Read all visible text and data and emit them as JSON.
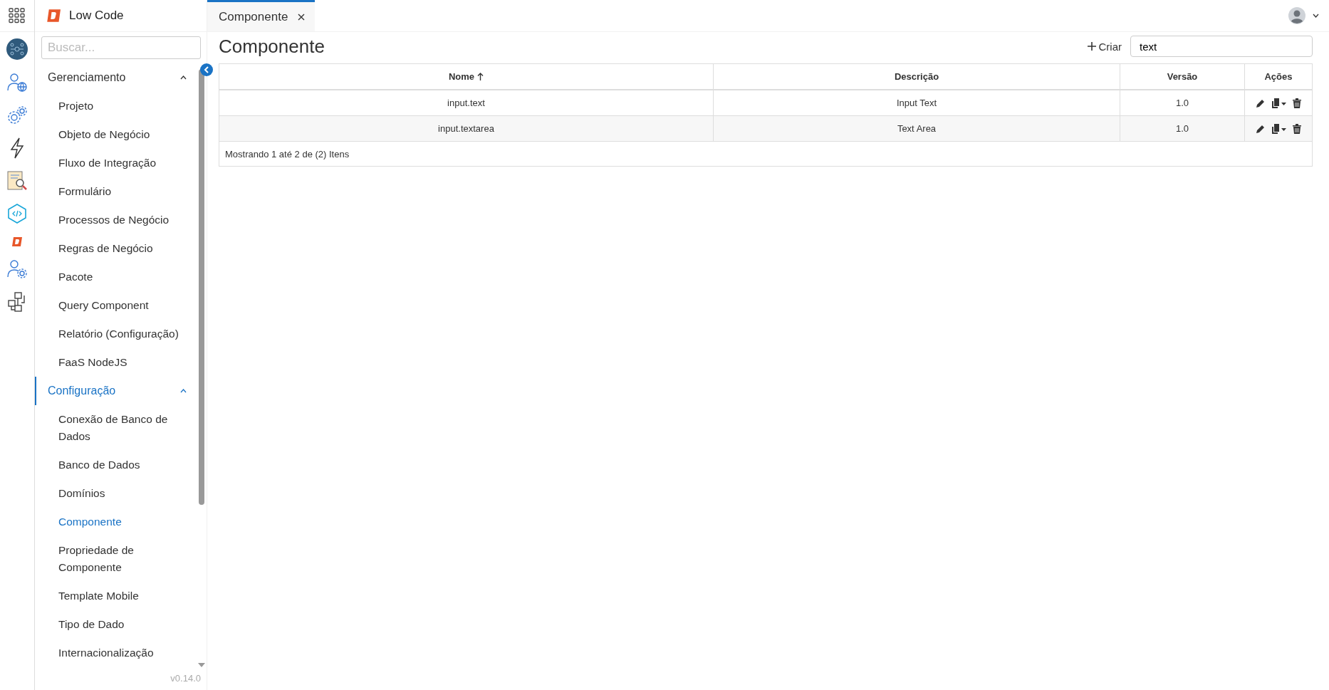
{
  "app_title": "Low Code",
  "sidebar": {
    "search": {
      "placeholder": "Buscar..."
    },
    "groups": [
      {
        "label": "Gerenciamento",
        "expanded": true,
        "selected": false,
        "children": [
          {
            "label": "Projeto",
            "selected": false
          },
          {
            "label": "Objeto de Negócio",
            "selected": false
          },
          {
            "label": "Fluxo de Integração",
            "selected": false
          },
          {
            "label": "Formulário",
            "selected": false
          },
          {
            "label": "Processos de Negócio",
            "selected": false
          },
          {
            "label": "Regras de Negócio",
            "selected": false
          },
          {
            "label": "Pacote",
            "selected": false
          },
          {
            "label": "Query Component",
            "selected": false
          },
          {
            "label": "Relatório (Configuração)",
            "selected": false
          },
          {
            "label": "FaaS NodeJS",
            "selected": false
          }
        ]
      },
      {
        "label": "Configuração",
        "expanded": true,
        "selected": true,
        "children": [
          {
            "label": "Conexão de Banco de Dados",
            "selected": false
          },
          {
            "label": "Banco de Dados",
            "selected": false
          },
          {
            "label": "Domínios",
            "selected": false
          },
          {
            "label": "Componente",
            "selected": true
          },
          {
            "label": "Propriedade de Componente",
            "selected": false
          },
          {
            "label": "Template Mobile",
            "selected": false
          },
          {
            "label": "Tipo de Dado",
            "selected": false
          },
          {
            "label": "Internacionalização",
            "selected": false
          }
        ]
      }
    ],
    "version": "v0.14.0"
  },
  "tabs": [
    {
      "label": "Componente",
      "selected": true
    }
  ],
  "page": {
    "title": "Componente",
    "create_button": "Criar",
    "search": {
      "value": "text"
    }
  },
  "table": {
    "columns": [
      {
        "label": "Nome",
        "sorted": true
      },
      {
        "label": "Descrição",
        "sorted": false
      },
      {
        "label": "Versão",
        "sorted": false
      },
      {
        "label": "Ações",
        "sorted": false
      }
    ],
    "rows": [
      {
        "cells": [
          "input.text",
          "Input Text",
          "1.0"
        ]
      },
      {
        "cells": [
          "input.textarea",
          "Text Area",
          "1.0"
        ]
      }
    ],
    "footer": "Mostrando 1 até 2 de (2) Itens"
  }
}
